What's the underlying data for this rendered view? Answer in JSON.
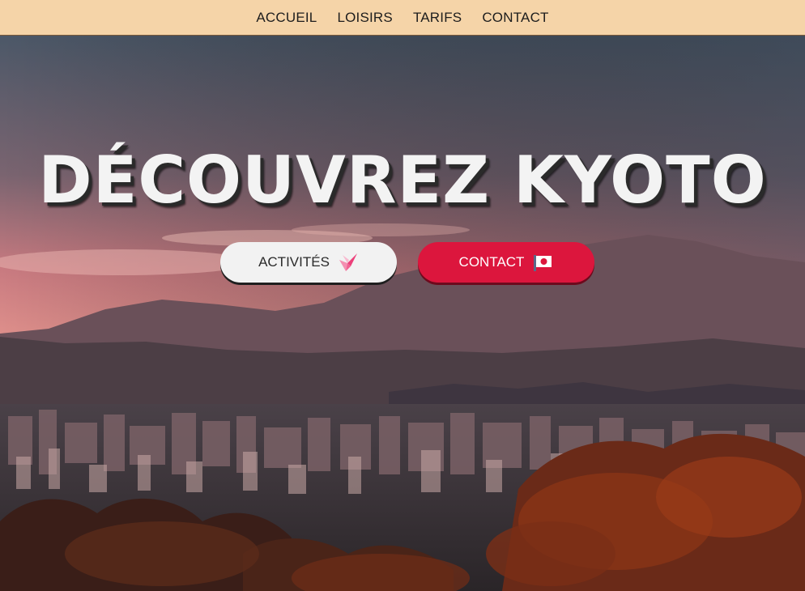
{
  "nav": {
    "items": [
      {
        "label": "ACCUEIL"
      },
      {
        "label": "LOISIRS"
      },
      {
        "label": "TARIFS"
      },
      {
        "label": "CONTACT"
      }
    ]
  },
  "hero": {
    "title": "DÉCOUVREZ KYOTO",
    "buttons": {
      "activites": {
        "label": "ACTIVITÉS",
        "icon": "origami-crane-icon"
      },
      "contact": {
        "label": "CONTACT",
        "icon": "japan-flag-icon"
      }
    }
  },
  "colors": {
    "navbar": "#f5d4a8",
    "contact_button": "#dc163d",
    "activities_button": "#f2f2f2"
  }
}
